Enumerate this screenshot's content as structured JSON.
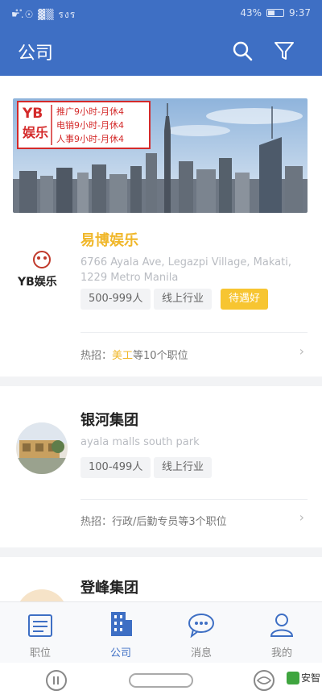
{
  "status": {
    "left": "☛ໍ.ໍ☉ ▓▒ รงร",
    "battery": "43%",
    "time": "9:37"
  },
  "header": {
    "title": "公司"
  },
  "companies": [
    {
      "name": "易博娱乐",
      "address": "6766 Ayala Ave, Legazpi Village, Makati, 1229 Metro Manila",
      "tags": [
        "500-999人",
        "线上行业",
        "待遇好"
      ],
      "hot_prefix": "热招：",
      "hot_keyword": "美工",
      "hot_suffix": "等10个职位",
      "logo_text": "YB娱乐",
      "banner": {
        "logo_line1": "YB",
        "logo_line2": "娱乐",
        "lines": [
          "推广9小时-月休4",
          "电销9小时-月休4",
          "人事9小时-月休4"
        ]
      }
    },
    {
      "name": "银河集团",
      "address": "ayala malls south park",
      "tags": [
        "100-499人",
        "线上行业"
      ],
      "hot_prefix": "热招：",
      "hot_text": "行政/后勤专员等3个职位"
    },
    {
      "name": "登峰集团"
    }
  ],
  "tabs": [
    {
      "label": "职位",
      "icon": "list-icon"
    },
    {
      "label": "公司",
      "icon": "building-icon"
    },
    {
      "label": "消息",
      "icon": "chat-icon"
    },
    {
      "label": "我的",
      "icon": "profile-icon"
    }
  ],
  "system": {
    "watermark": "安智"
  },
  "colors": {
    "primary": "#3e6fc4",
    "accent": "#f7c531",
    "company_name_yellow": "#f0b72a"
  }
}
